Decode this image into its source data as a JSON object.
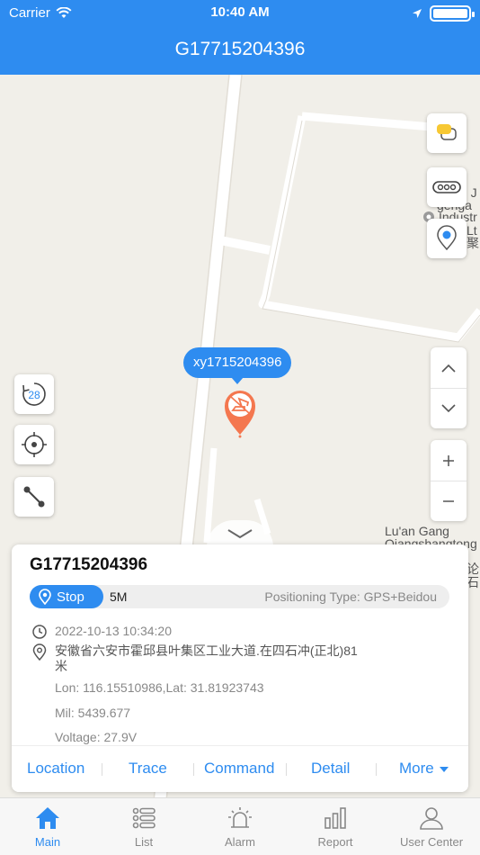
{
  "status_bar": {
    "carrier": "Carrier",
    "time": "10:40 AM"
  },
  "header": {
    "title": "G17715204396"
  },
  "map": {
    "labels": [
      {
        "text": "n J"
      },
      {
        "text": "genga"
      },
      {
        "text": "Industr"
      },
      {
        "text": "Lt"
      },
      {
        "text": "聚"
      },
      {
        "text": "Lu'an Gang"
      },
      {
        "text": "Qiangshangtong"
      },
      {
        "text": "论石"
      }
    ],
    "device_label": "xy1715204396",
    "replay_badge": "28",
    "marker_color": "#f4774f",
    "accent_color": "#2e8cf0"
  },
  "card": {
    "title": "G17715204396",
    "status": "Stop",
    "distance": "5M",
    "positioning_type": "Positioning Type: GPS+Beidou",
    "time": "2022-10-13 10:34:20",
    "address": "安徽省六安市霍邱县叶集区工业大道.在四石冲(正北)81米",
    "coords": "Lon: 116.15510986,Lat: 31.81923743",
    "mileage": "Mil: 5439.677",
    "voltage": "Voltage: 27.9V",
    "actions": [
      "Location",
      "Trace",
      "Command",
      "Detail",
      "More"
    ]
  },
  "tabbar": {
    "tabs": [
      {
        "label": "Main",
        "icon": "home-icon",
        "active": true
      },
      {
        "label": "List",
        "icon": "list-icon",
        "active": false
      },
      {
        "label": "Alarm",
        "icon": "alarm-icon",
        "active": false
      },
      {
        "label": "Report",
        "icon": "report-icon",
        "active": false
      },
      {
        "label": "User Center",
        "icon": "user-icon",
        "active": false
      }
    ]
  }
}
